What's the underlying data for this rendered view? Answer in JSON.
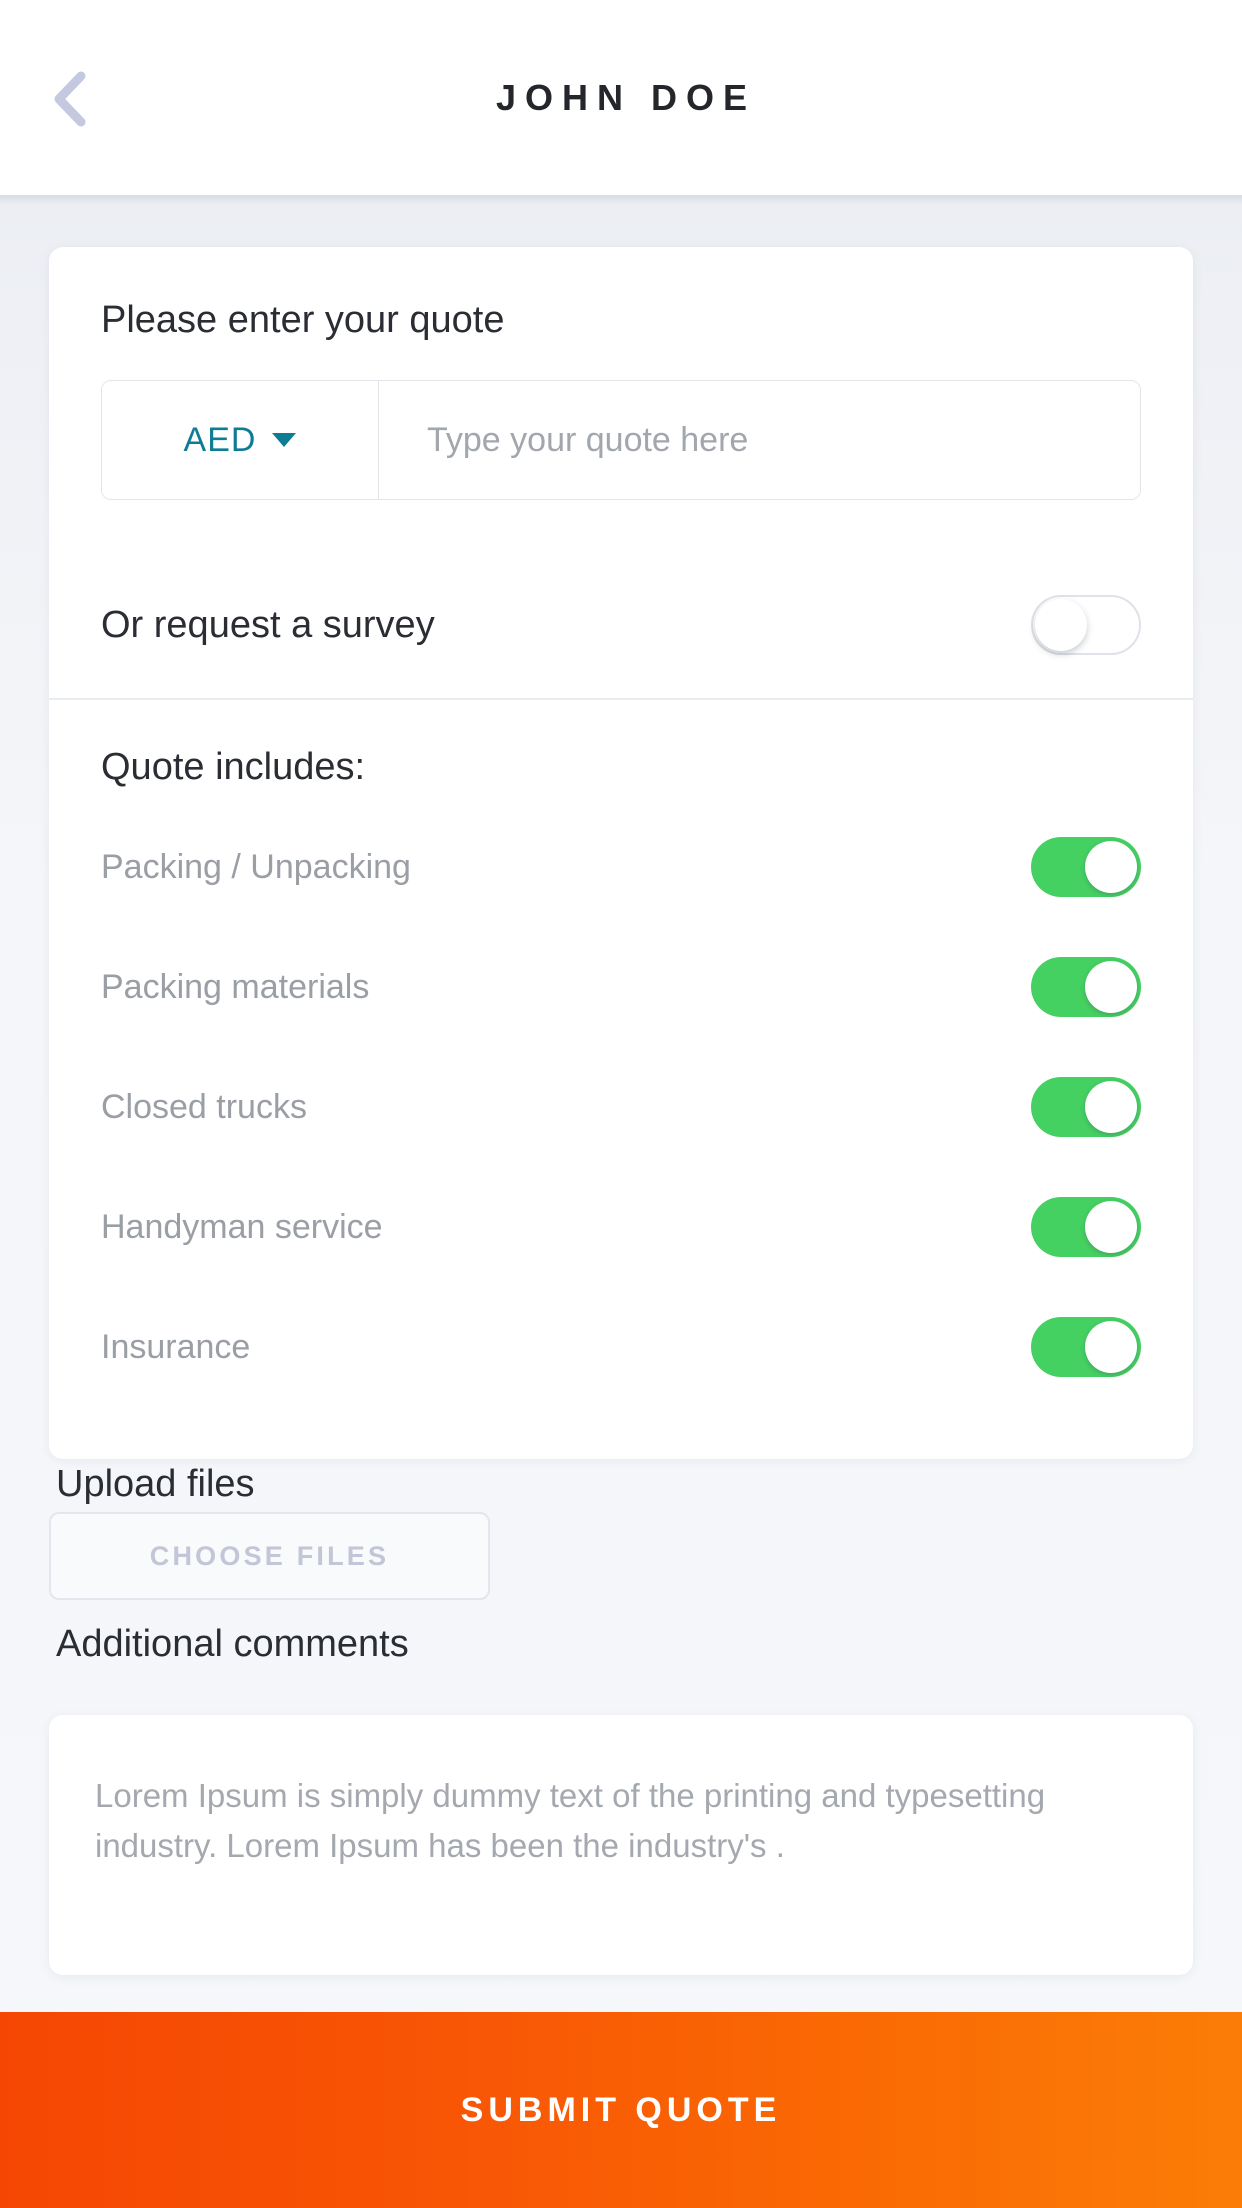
{
  "header": {
    "title": "JOHN DOE",
    "back_icon": "chevron-left-icon"
  },
  "quote_card": {
    "title": "Please enter your quote",
    "currency": {
      "selected": "AED",
      "caret_icon": "caret-down-icon"
    },
    "amount_placeholder": "Type your quote here",
    "amount_value": "",
    "survey": {
      "label": "Or request a survey",
      "enabled": false
    },
    "includes_title": "Quote includes:",
    "includes": [
      {
        "label": "Packing / Unpacking",
        "enabled": true
      },
      {
        "label": "Packing materials",
        "enabled": true
      },
      {
        "label": "Closed trucks",
        "enabled": true
      },
      {
        "label": "Handyman service",
        "enabled": true
      },
      {
        "label": "Insurance",
        "enabled": true
      }
    ]
  },
  "upload": {
    "title": "Upload files",
    "button_label": "CHOOSE FILES"
  },
  "comments": {
    "title": "Additional comments",
    "placeholder": "Lorem Ipsum is simply dummy text of the printing and typesetting industry. Lorem Ipsum has been the industry's .",
    "value": ""
  },
  "submit": {
    "label": "SUBMIT QUOTE"
  },
  "colors": {
    "accent_teal": "#0d7c94",
    "toggle_on_green": "#45d062",
    "submit_orange_start": "#f54703",
    "submit_orange_end": "#fb7d07",
    "back_chevron": "#c5c9e0",
    "page_background": "#f4f6f9"
  }
}
